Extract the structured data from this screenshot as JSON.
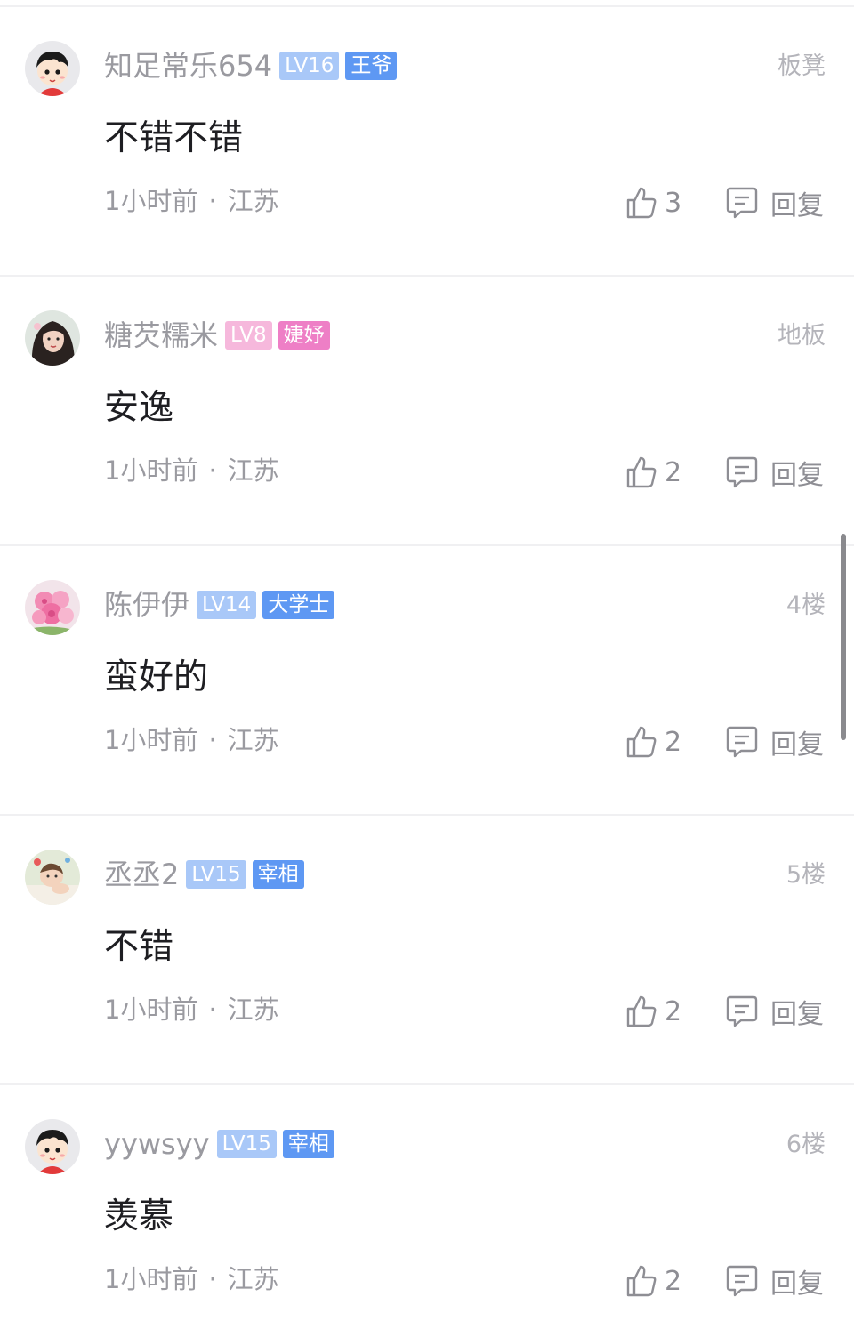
{
  "comments": [
    {
      "username": "知足常乐654",
      "level_badge": "LV16",
      "title_badge": "王爷",
      "level_color": "#a9c8f8",
      "title_color": "#5e98f3",
      "floor": "板凳",
      "content": "不错不错",
      "time": "1小时前",
      "location": "江苏",
      "likes": "3",
      "reply_label": "回复",
      "avatar": "cartoon-boy-avatar"
    },
    {
      "username": "糖芡糯米",
      "level_badge": "LV8",
      "title_badge": "婕妤",
      "level_color": "#f6b8dc",
      "title_color": "#ee7fc6",
      "floor": "地板",
      "content": "安逸",
      "time": "1小时前",
      "location": "江苏",
      "likes": "2",
      "reply_label": "回复",
      "avatar": "girl-photo-avatar"
    },
    {
      "username": "陈伊伊",
      "level_badge": "LV14",
      "title_badge": "大学士",
      "level_color": "#a9c8f8",
      "title_color": "#5e98f3",
      "floor": "4楼",
      "content": "蛮好的",
      "time": "1小时前",
      "location": "江苏",
      "likes": "2",
      "reply_label": "回复",
      "avatar": "pink-flower-avatar"
    },
    {
      "username": "丞丞2",
      "level_badge": "LV15",
      "title_badge": "宰相",
      "level_color": "#a9c8f8",
      "title_color": "#5e98f3",
      "floor": "5楼",
      "content": "不错",
      "time": "1小时前",
      "location": "江苏",
      "likes": "2",
      "reply_label": "回复",
      "avatar": "baby-photo-avatar"
    },
    {
      "username": "yywsyy",
      "level_badge": "LV15",
      "title_badge": "宰相",
      "level_color": "#a9c8f8",
      "title_color": "#5e98f3",
      "floor": "6楼",
      "content": "羡慕",
      "time": "1小时前",
      "location": "江苏",
      "likes": "2",
      "reply_label": "回复",
      "avatar": "cartoon-boy-avatar"
    }
  ],
  "separator": "·"
}
